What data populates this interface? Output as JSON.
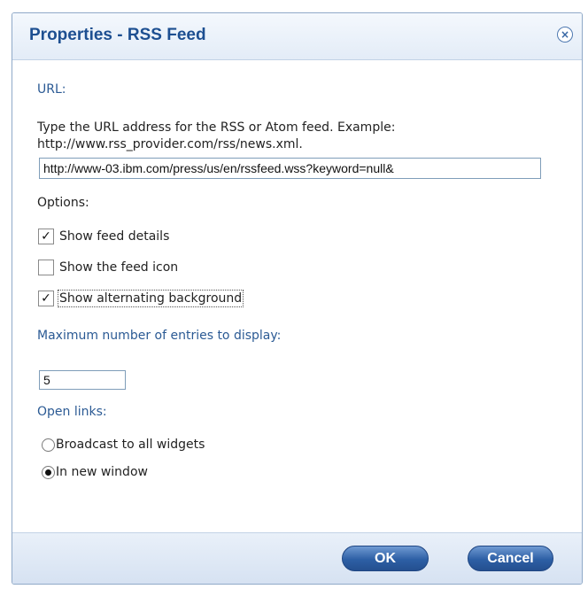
{
  "dialog": {
    "title": "Properties - RSS Feed",
    "close_symbol": "×"
  },
  "url_section": {
    "label": "URL:",
    "description": "Type the URL address for the RSS or Atom feed. Example: http://www.rss_provider.com/rss/news.xml.",
    "value": "http://www-03.ibm.com/press/us/en/rssfeed.wss?keyword=null&"
  },
  "options": {
    "label": "Options:",
    "items": [
      {
        "label": "Show feed details",
        "checked": true,
        "mark": "✓"
      },
      {
        "label": "Show the feed icon",
        "checked": false,
        "mark": ""
      },
      {
        "label": "Show alternating background",
        "checked": true,
        "mark": "✓"
      }
    ]
  },
  "max_entries": {
    "label": "Maximum number of entries to display:",
    "value": "5"
  },
  "open_links": {
    "label": "Open links:",
    "choices": [
      {
        "label": "Broadcast to all widgets",
        "selected": false
      },
      {
        "label": "In new window",
        "selected": true
      }
    ]
  },
  "buttons": {
    "ok": "OK",
    "cancel": "Cancel"
  },
  "colors": {
    "title": "#1d4f91",
    "section_label": "#2b5a94",
    "button": "#2d5fa5"
  }
}
